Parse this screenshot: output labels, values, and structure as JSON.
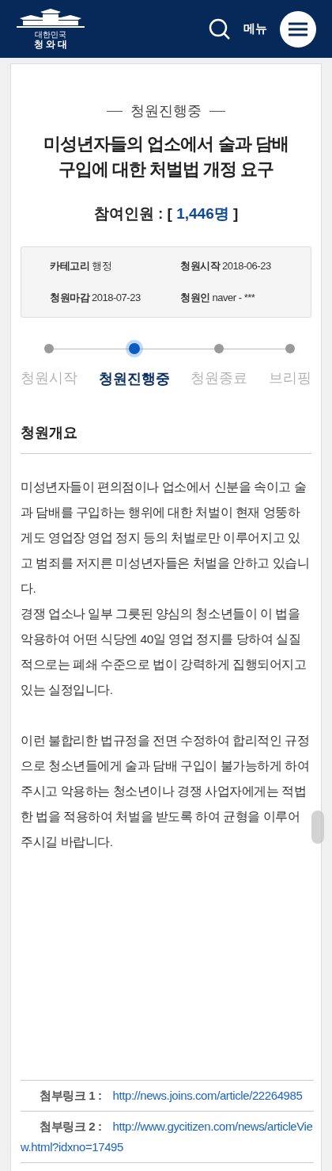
{
  "header": {
    "logo_small": "대한민국",
    "logo_text": "청 와 대",
    "menu_label": "메뉴"
  },
  "status": "청원진행중",
  "title": "미성년자들의 업소에서 술과 담배 구입에 대한 처벌법 개정 요구",
  "participants": {
    "label": "참여인원 : [",
    "count": "1,446명",
    "close": "]"
  },
  "info": [
    {
      "label": "카테고리",
      "value": "행정"
    },
    {
      "label": "청원시작",
      "value": "2018-06-23"
    },
    {
      "label": "청원마감",
      "value": "2018-07-23"
    },
    {
      "label": "청원인",
      "value": "naver - ***"
    }
  ],
  "steps": [
    {
      "label": "청원시작",
      "selected": false
    },
    {
      "label": "청원진행중",
      "selected": true
    },
    {
      "label": "청원종료",
      "selected": false
    },
    {
      "label": "브리핑",
      "selected": false
    }
  ],
  "section_title": "청원개요",
  "paragraphs": [
    "미성년자들이 편의점이나 업소에서 신분을 속이고 술과 담배를 구입하는 행위에 대한 처벌이 현재 엉뚱하게도 영업장 영업 정지 등의 처벌로만 이루어지고 있고 범죄를 저지른 미성년자들은 처벌을 안하고 있습니다.",
    "경쟁 업소나 일부 그릇된 양심의 청소년들이 이 법을 악용하여 어떤 식당엔 40일 영업 정지를 당하여 실질적으로는 폐쇄 수준으로 법이 강력하게 집행되어지고 있는 실정입니다.",
    "이런 불합리한 법규정을 전면 수정하여 합리적인 규정으로 청소년들에게 술과 담배 구입이 불가능하게 하여 주시고 악용하는 청소년이나 경쟁 사업자에게는 적법한 법을 적용하여 처벌을 받도록 하여 균형을 이루어 주시길 바랍니다."
  ],
  "links": [
    {
      "label": "첨부링크 1 :",
      "url": "http://news.joins.com/article/22264985"
    },
    {
      "label": "첨부링크 2 :",
      "url": "http://www.gycitizen.com/news/articleView.html?idxno=17495"
    }
  ]
}
